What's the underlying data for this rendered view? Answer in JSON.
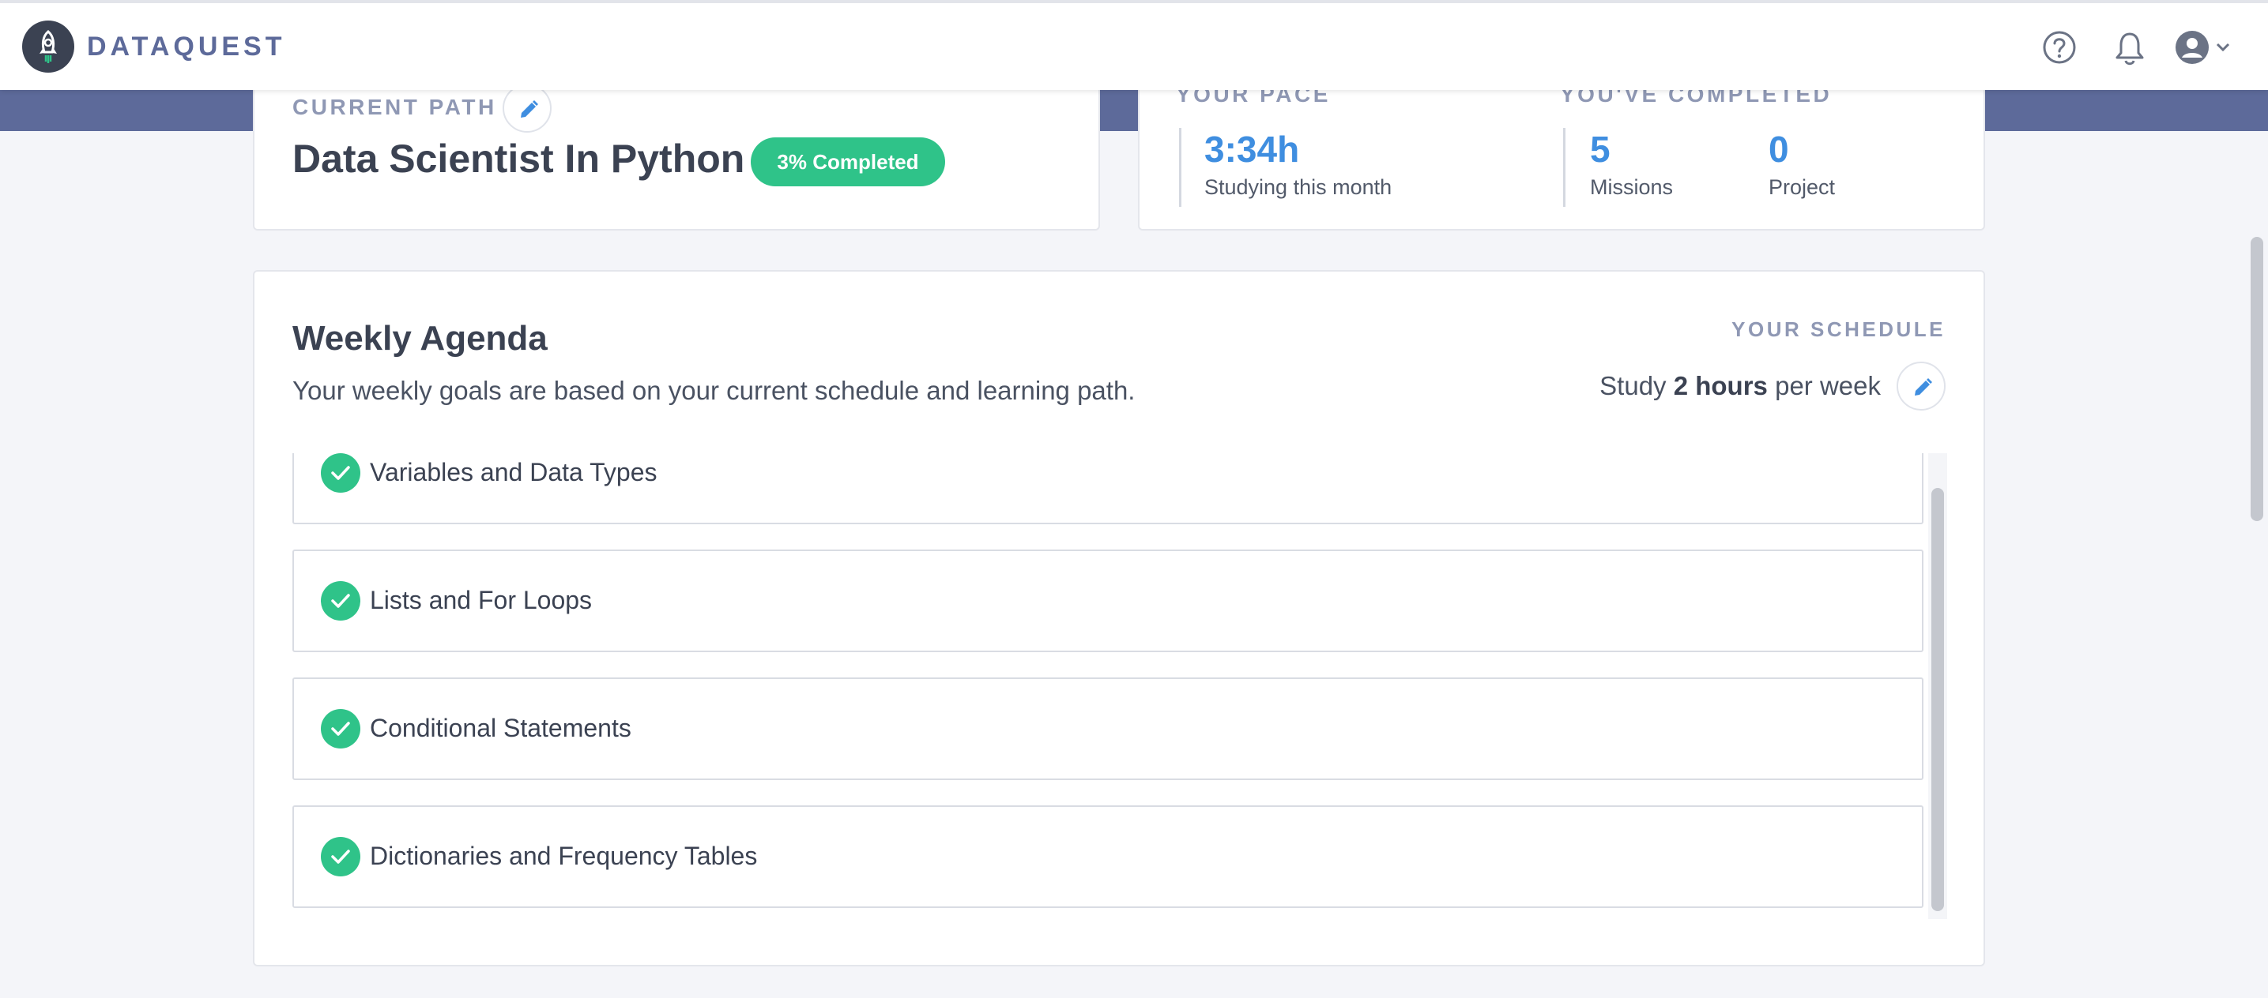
{
  "header": {
    "brand": "DATAQUEST",
    "icons": [
      "rocket-logo-icon",
      "help-icon",
      "bell-icon",
      "user-avatar-icon",
      "chevron-down-icon"
    ]
  },
  "current_path": {
    "eyebrow": "CURRENT PATH",
    "title": "Data Scientist In Python",
    "badge": "3% Completed",
    "progress_percent": 3
  },
  "pace": {
    "pace_eyebrow": "YOUR PACE",
    "completed_eyebrow": "YOU'VE COMPLETED",
    "time_value": "3:34h",
    "time_label": "Studying this month",
    "missions_value": "5",
    "missions_label": "Missions",
    "project_value": "0",
    "project_label": "Project"
  },
  "agenda": {
    "title": "Weekly Agenda",
    "description": "Your weekly goals are based on your current schedule and learning path.",
    "schedule_eyebrow": "YOUR SCHEDULE",
    "schedule_prefix": "Study ",
    "schedule_hours": "2 hours",
    "schedule_suffix": " per week",
    "missions": [
      {
        "label": "Variables and Data Types",
        "completed": true
      },
      {
        "label": "Lists and For Loops",
        "completed": true
      },
      {
        "label": "Conditional Statements",
        "completed": true
      },
      {
        "label": "Dictionaries and Frequency Tables",
        "completed": true
      }
    ]
  },
  "colors": {
    "accent_blue": "#3f8ee0",
    "success_green": "#2fc389",
    "band_slate": "#5d6a9a",
    "page_bg": "#f4f5f9"
  }
}
